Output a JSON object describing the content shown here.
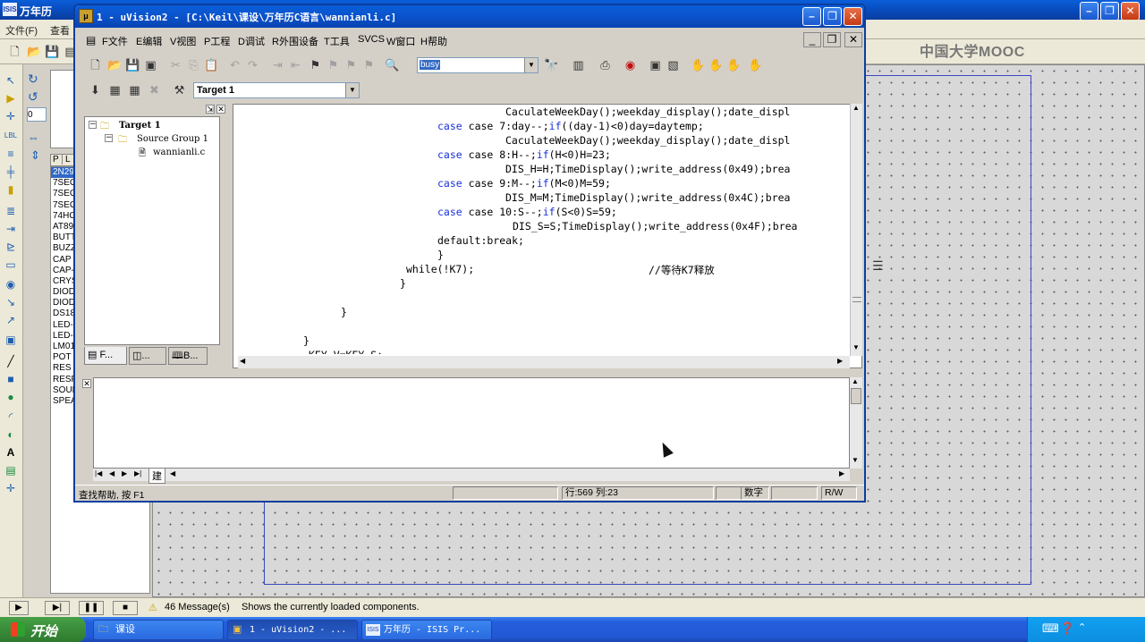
{
  "isis": {
    "title": "万年历",
    "menu": [
      "文件(F)",
      "查看"
    ],
    "mooc_logo": "中国大学MOOC",
    "device_header": [
      "P",
      "L"
    ],
    "devices": [
      "2N29",
      "7SEG",
      "7SEG",
      "7SEG",
      "74HC",
      "AT89",
      "BUTT",
      "BUZZ",
      "CAP",
      "CAP-",
      "CRYS",
      "DIOD",
      "DIOD",
      "DS18",
      "LED-",
      "LED-",
      "LM01",
      "POT",
      "RES",
      "RESP",
      "SOUN",
      "SPEA"
    ],
    "selected_device_index": 0,
    "rotation_value": "0",
    "status_messages": "46 Message(s)",
    "status_text": "Shows the currently loaded components."
  },
  "uvision": {
    "title": "1  - uVision2 - [C:\\Keil\\课设\\万年历C语言\\wannianli.c]",
    "menu": [
      "F文件",
      "E编辑",
      "V视图",
      "P工程",
      "D调试",
      "R外围设备",
      "T工具",
      "SVCS",
      "W窗口",
      "H帮助"
    ],
    "find_value": "busy",
    "target": "Target 1",
    "project_tree": {
      "target": "Target 1",
      "group": "Source Group 1",
      "file": "wannianli.c"
    },
    "project_tabs": [
      "F...",
      "...",
      "B..."
    ],
    "output_tab": "建",
    "code": [
      "CaculateWeekDay();weekday_display();date_displ",
      "case 7:day--;if((day-1)<0)day=daytemp;",
      "CaculateWeekDay();weekday_display();date_displ",
      "case 8:H--;if(H<0)H=23;",
      "DIS_H=H;TimeDisplay();write_address(0x49);brea",
      "case 9:M--;if(M<0)M=59;",
      "DIS_M=M;TimeDisplay();write_address(0x4C);brea",
      "case 10:S--;if(S<0)S=59;",
      "DIS_S=S;TimeDisplay();write_address(0x4F);brea",
      "default:break;",
      "}",
      "while(!K7);",
      "//等待K7释放",
      "}",
      "}",
      "}",
      "KEY_V=KEY_S;"
    ],
    "status": {
      "help": "查找帮助, 按 F1",
      "position": "行:569 列:23",
      "mode": "数字",
      "rw": "R/W"
    }
  },
  "taskbar": {
    "start": "开始",
    "tasks": [
      "课设",
      "1  - uVision2 - ...",
      "万年历 - ISIS Pr..."
    ]
  },
  "colors": {
    "keyword": "#1a30d8",
    "comment": "#008000",
    "titlebar": "#0a52cc"
  }
}
